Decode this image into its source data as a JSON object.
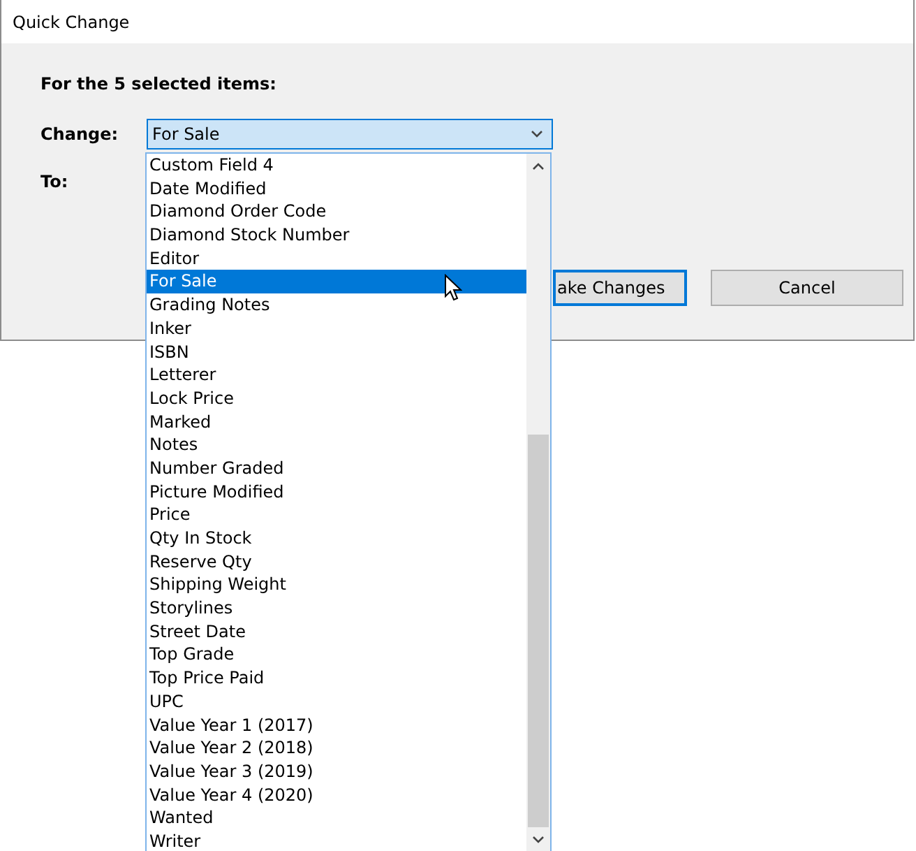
{
  "window": {
    "title": "Quick Change"
  },
  "heading": "For the 5 selected items:",
  "change": {
    "label": "Change:",
    "value": "For Sale",
    "expanded": true
  },
  "to": {
    "label": "To:"
  },
  "options": [
    {
      "label": "Custom Field 4",
      "selected": false
    },
    {
      "label": "Date Modified",
      "selected": false
    },
    {
      "label": "Diamond Order Code",
      "selected": false
    },
    {
      "label": "Diamond Stock Number",
      "selected": false
    },
    {
      "label": "Editor",
      "selected": false
    },
    {
      "label": "For Sale",
      "selected": true
    },
    {
      "label": "Grading Notes",
      "selected": false
    },
    {
      "label": "Inker",
      "selected": false
    },
    {
      "label": "ISBN",
      "selected": false
    },
    {
      "label": "Letterer",
      "selected": false
    },
    {
      "label": "Lock Price",
      "selected": false
    },
    {
      "label": "Marked",
      "selected": false
    },
    {
      "label": "Notes",
      "selected": false
    },
    {
      "label": "Number Graded",
      "selected": false
    },
    {
      "label": "Picture Modified",
      "selected": false
    },
    {
      "label": "Price",
      "selected": false
    },
    {
      "label": "Qty In Stock",
      "selected": false
    },
    {
      "label": "Reserve Qty",
      "selected": false
    },
    {
      "label": "Shipping Weight",
      "selected": false
    },
    {
      "label": "Storylines",
      "selected": false
    },
    {
      "label": "Street Date",
      "selected": false
    },
    {
      "label": "Top Grade",
      "selected": false
    },
    {
      "label": "Top Price Paid",
      "selected": false
    },
    {
      "label": "UPC",
      "selected": false
    },
    {
      "label": "Value Year 1 (2017)",
      "selected": false
    },
    {
      "label": "Value Year 2 (2018)",
      "selected": false
    },
    {
      "label": "Value Year 3 (2019)",
      "selected": false
    },
    {
      "label": "Value Year 4 (2020)",
      "selected": false
    },
    {
      "label": "Wanted",
      "selected": false
    },
    {
      "label": "Writer",
      "selected": false
    }
  ],
  "buttons": [
    {
      "label": "ake Changes",
      "kind": "default"
    },
    {
      "label": "Cancel",
      "kind": "normal"
    }
  ]
}
